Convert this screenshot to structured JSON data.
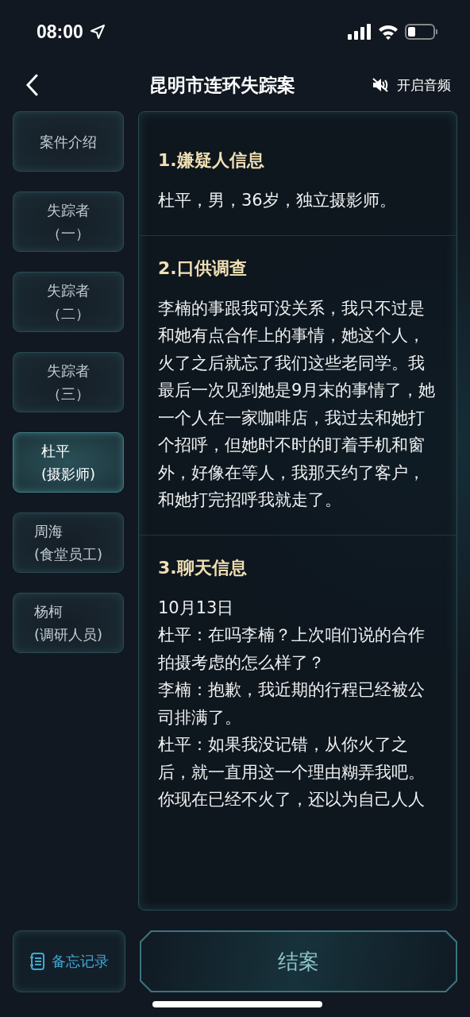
{
  "status_bar": {
    "time": "08:00"
  },
  "header": {
    "title": "昆明市连环失踪案",
    "audio_label": "开启音频"
  },
  "sidebar": {
    "items": [
      {
        "kind": "centered",
        "name": "案件介绍",
        "selected": false
      },
      {
        "kind": "centered",
        "name": "失踪者",
        "sub": "（一）",
        "selected": false
      },
      {
        "kind": "centered",
        "name": "失踪者",
        "sub": "（二）",
        "selected": false
      },
      {
        "kind": "centered",
        "name": "失踪者",
        "sub": "（三）",
        "selected": false
      },
      {
        "kind": "left",
        "name": "杜平",
        "sub": "(摄影师)",
        "selected": true
      },
      {
        "kind": "left",
        "name": "周海",
        "sub": "(食堂员工)",
        "selected": false
      },
      {
        "kind": "left",
        "name": "杨柯",
        "sub": "(调研人员)",
        "selected": false
      }
    ]
  },
  "content": {
    "sections": [
      {
        "heading": "1.嫌疑人信息",
        "lines": [
          "杜平，男，36岁，独立摄影师。"
        ]
      },
      {
        "heading": "2.口供调查",
        "lines": [
          "李楠的事跟我可没关系，我只不过是和她有点合作上的事情，她这个人，火了之后就忘了我们这些老同学。我最后一次见到她是9月末的事情了，她一个人在一家咖啡店，我过去和她打个招呼，但她时不时的盯着手机和窗外，好像在等人，我那天约了客户，和她打完招呼我就走了。"
        ]
      },
      {
        "heading": "3.聊天信息",
        "lines": [
          "10月13日",
          "杜平：在吗李楠？上次咱们说的合作拍摄考虑的怎么样了？",
          "李楠：抱歉，我近期的行程已经被公司排满了。",
          "杜平：如果我没记错，从你火了之后，就一直用这一个理由糊弄我吧。你现在已经不火了，还以为自己人人"
        ]
      }
    ]
  },
  "footer": {
    "memo_button": "备忘记录",
    "close_case_button": "结案"
  }
}
